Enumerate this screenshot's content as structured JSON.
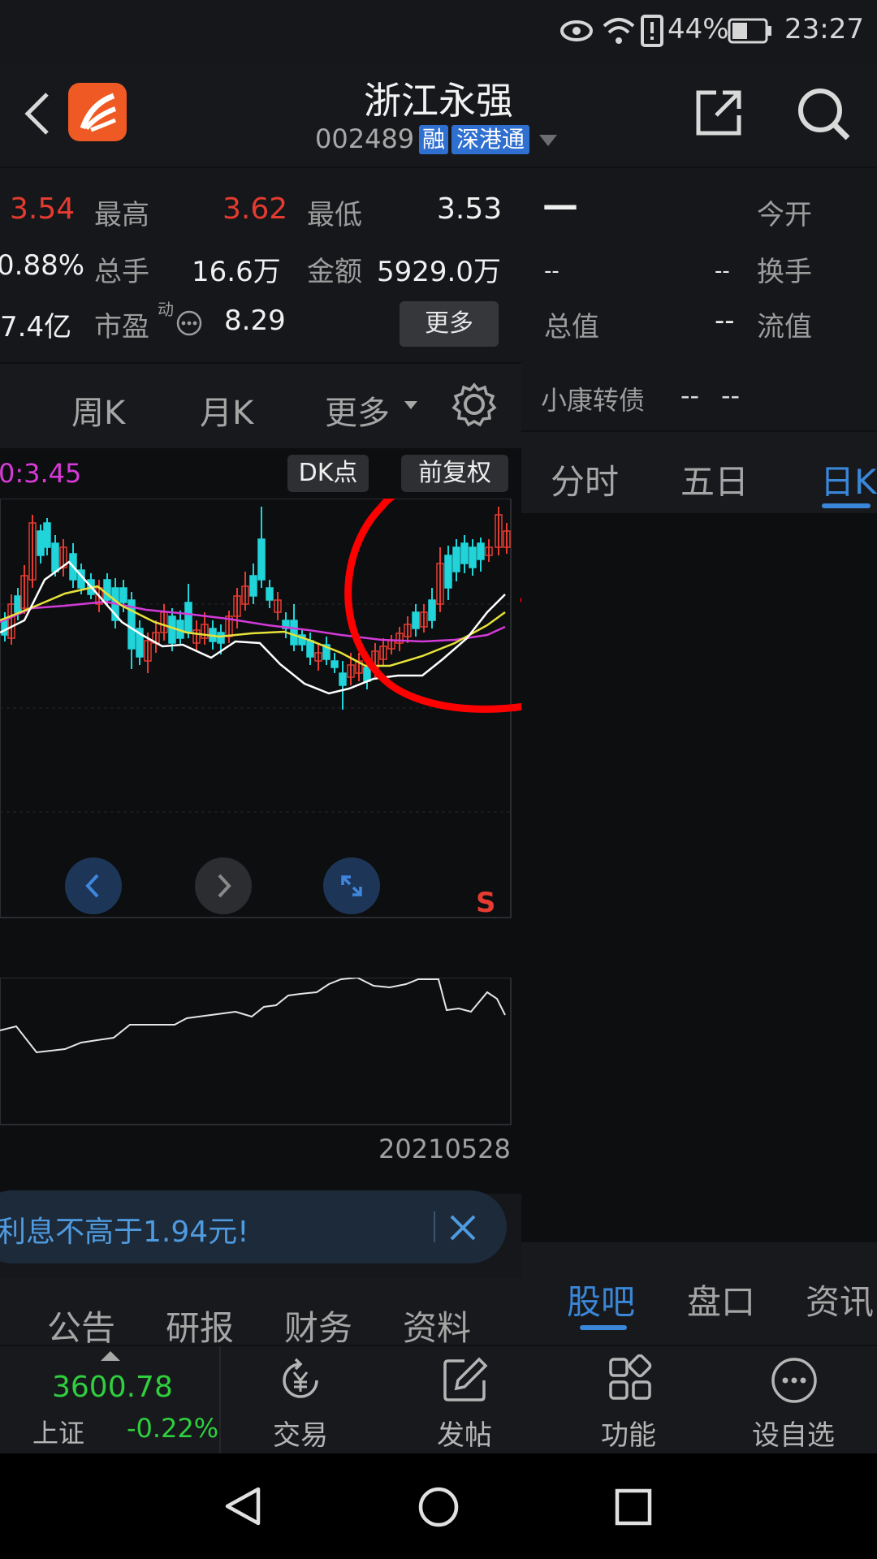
{
  "status": {
    "battery": "44%",
    "time": "23:27"
  },
  "header": {
    "title": "浙江永强",
    "code": "002489",
    "tag_rong": "融",
    "tag_sgt": "深港通"
  },
  "quote": {
    "price_partial": "3.54",
    "high_label": "最高",
    "high_value": "3.62",
    "low_label": "最低",
    "low_value": "3.53",
    "pct_partial": "0.88%",
    "vol_label": "总手",
    "vol_value": "16.6万",
    "amt_label": "金额",
    "amt_value": "5929.0万",
    "cap_partial": "7.4亿",
    "pe_label": "市盈",
    "pe_sup": "动",
    "pe_value": "8.29",
    "more_btn": "更多"
  },
  "right_quote": {
    "dash_big": "—",
    "open_label": "今开",
    "row2_a": "--",
    "row2_b": "--",
    "turnover_label": "换手",
    "total_label": "总值",
    "total_value": "--",
    "float_label": "流值",
    "bond_label": "小康转债",
    "bond_v1": "--",
    "bond_v2": "--"
  },
  "period_tabs": {
    "week": "周K",
    "month": "月K",
    "more": "更多"
  },
  "right_tabs": {
    "fenshi": "分时",
    "wuri": "五日",
    "rik": "日K"
  },
  "chart_top": {
    "ma_partial": "0:3.45",
    "dk_btn": "DK点",
    "fq_btn": "前复权",
    "s_mark": "S"
  },
  "chart_date": "20210528",
  "ad_banner": {
    "text": "利息不高于1.94元!"
  },
  "bottom_tabs_left": [
    "公告",
    "研报",
    "财务",
    "资料"
  ],
  "bottom_tabs_right": [
    "股吧",
    "盘口",
    "资讯"
  ],
  "index": {
    "value": "3600.78",
    "name": "上证",
    "change": "-0.22%"
  },
  "nav": [
    "交易",
    "发帖",
    "功能",
    "设自选"
  ],
  "colors": {
    "up": "#e53b30",
    "down": "#21d4d9",
    "accent": "#3a86d8",
    "annotation": "#ff0000"
  }
}
